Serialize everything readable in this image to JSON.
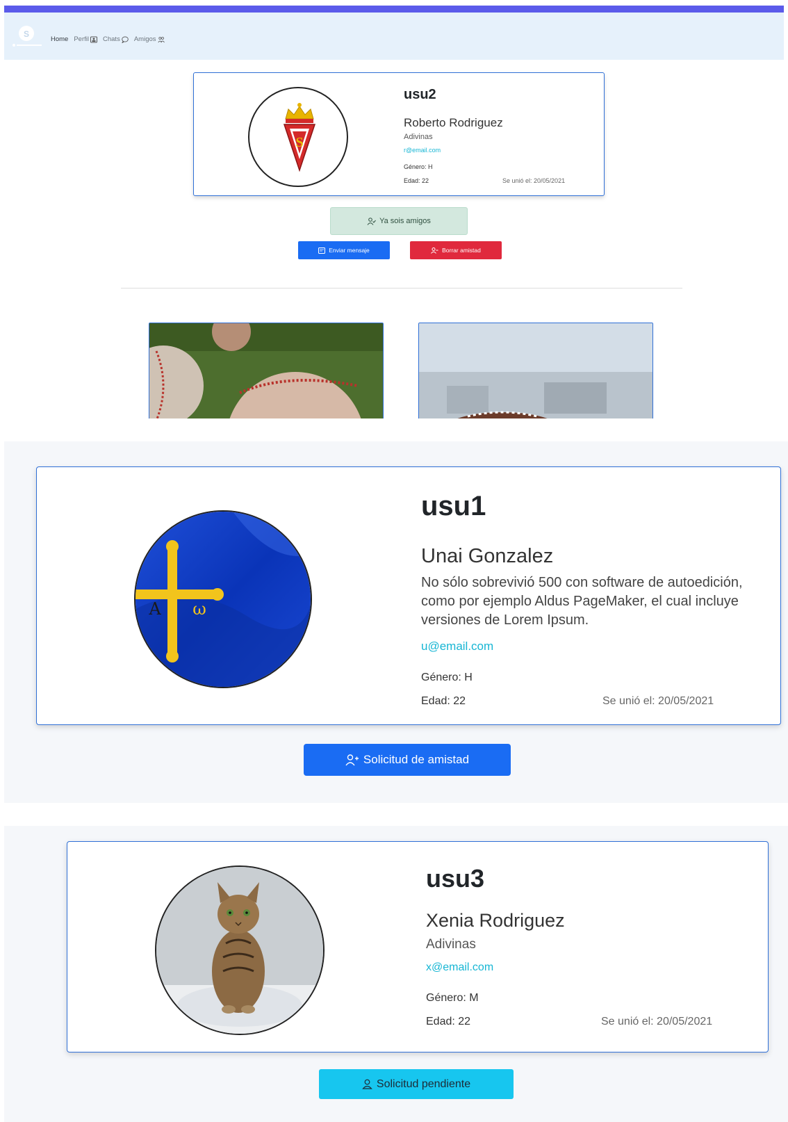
{
  "nav": {
    "links": [
      {
        "label": "Home",
        "icon": "none"
      },
      {
        "label": "Perfil",
        "icon": "profile-card-icon"
      },
      {
        "label": "Chats",
        "icon": "chat-bubble-icon"
      },
      {
        "label": "Amigos",
        "icon": "people-icon"
      }
    ]
  },
  "profile_top": {
    "username": "usu2",
    "full_name": "Roberto Rodriguez",
    "bio": "Adivinas",
    "email": "r@email.com",
    "gender": "Género: H",
    "age": "Edad: 22",
    "joined": "Se unió el: 20/05/2021",
    "avatar": "sporting-crest"
  },
  "actions_top": {
    "friends_status": "Ya sois amigos",
    "send_message": "Enviar mensaje",
    "delete_friend": "Borrar amistad"
  },
  "profile_usu1": {
    "username": "usu1",
    "full_name": "Unai Gonzalez",
    "bio": "No sólo sobrevivió 500 con software de autoedición, como por ejemplo Aldus PageMaker, el cual incluye versiones de Lorem Ipsum.",
    "email": "u@email.com",
    "gender": "Género: H",
    "age": "Edad: 22",
    "joined": "Se unió el: 20/05/2021",
    "avatar": "asturias-flag",
    "button": "Solicitud de amistad"
  },
  "profile_usu3": {
    "username": "usu3",
    "full_name": "Xenia Rodriguez",
    "bio": "Adivinas",
    "email": "x@email.com",
    "gender": "Género: M",
    "age": "Edad: 22",
    "joined": "Se unió el: 20/05/2021",
    "avatar": "cat-photo",
    "button": "Solicitud pendiente"
  },
  "colors": {
    "primary": "#1a6cf3",
    "danger": "#e0293d",
    "info": "#17c6ef",
    "success_light": "#d3e8de",
    "card_border": "#2e6fd6",
    "nav_bg": "#e6f1fb",
    "topbar": "#5b5bea"
  }
}
